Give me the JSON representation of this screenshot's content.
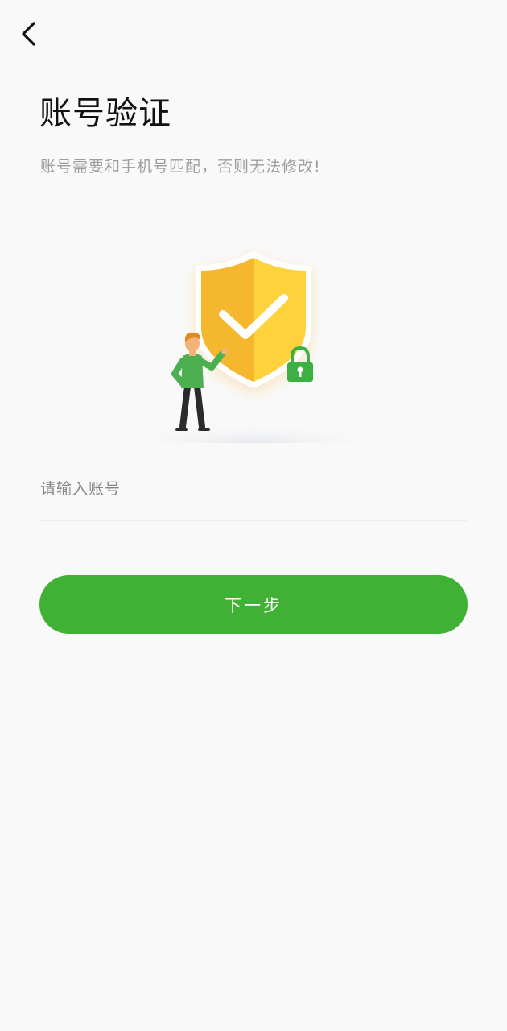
{
  "header": {
    "back_icon": "chevron-left-icon"
  },
  "page": {
    "title": "账号验证",
    "subtitle": "账号需要和手机号匹配，否则无法修改!"
  },
  "illustration": {
    "icons": [
      "shield-check-icon",
      "padlock-icon",
      "person-figure"
    ],
    "colors": {
      "shield_left": "#f5b72e",
      "shield_right": "#fdd23c",
      "check": "#ffffff",
      "lock": "#3cb043",
      "shirt": "#4caf50"
    }
  },
  "form": {
    "account_placeholder": "请输入账号",
    "account_value": ""
  },
  "actions": {
    "next_label": "下一步"
  },
  "colors": {
    "background": "#f9f9f9",
    "accent": "#41b136",
    "title": "#111111",
    "subtitle": "#9e9e9e"
  }
}
